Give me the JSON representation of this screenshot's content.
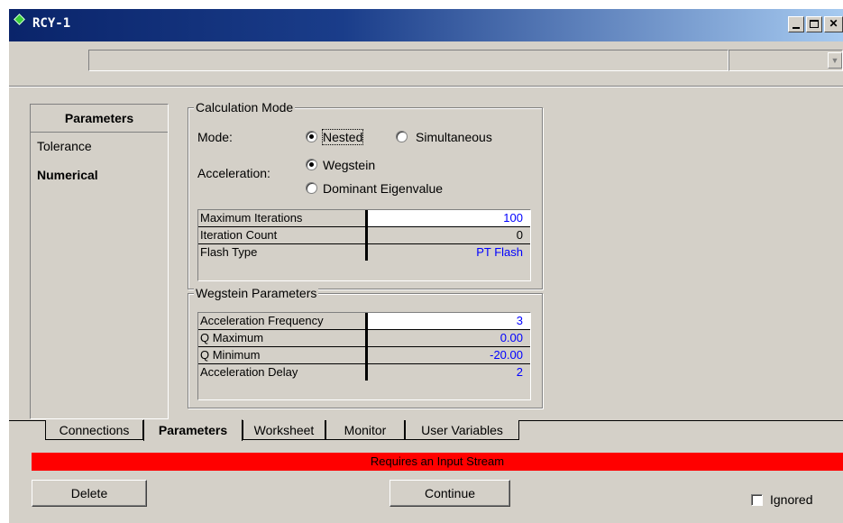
{
  "window": {
    "title": "RCY-1",
    "name_value": "",
    "combo_value": ""
  },
  "left_panel": {
    "header": "Parameters",
    "items": [
      {
        "label": "Tolerance",
        "selected": false
      },
      {
        "label": "Numerical",
        "selected": true
      }
    ]
  },
  "calc_mode": {
    "group_title": "Calculation Mode",
    "mode_label": "Mode:",
    "mode_options": [
      {
        "label": "Nested",
        "checked": true
      },
      {
        "label": "Simultaneous",
        "checked": false
      }
    ],
    "acceleration_label": "Acceleration:",
    "acceleration_options": [
      {
        "label": "Wegstein",
        "checked": true
      },
      {
        "label": "Dominant Eigenvalue",
        "checked": false
      }
    ],
    "table": [
      {
        "label": "Maximum Iterations",
        "value": "100"
      },
      {
        "label": "Iteration Count",
        "value": "0"
      },
      {
        "label": "Flash Type",
        "value": "PT Flash"
      }
    ]
  },
  "wegstein": {
    "group_title": "Wegstein Parameters",
    "table": [
      {
        "label": "Acceleration Frequency",
        "value": "3"
      },
      {
        "label": "Q Maximum",
        "value": "0.00"
      },
      {
        "label": "Q Minimum",
        "value": "-20.00"
      },
      {
        "label": "Acceleration Delay",
        "value": "2"
      }
    ]
  },
  "tabs": [
    {
      "label": "Connections",
      "active": false
    },
    {
      "label": "Parameters",
      "active": true
    },
    {
      "label": "Worksheet",
      "active": false
    },
    {
      "label": "Monitor",
      "active": false
    },
    {
      "label": "User Variables",
      "active": false
    }
  ],
  "status": {
    "text": "Requires an Input Stream",
    "color": "#ff0000"
  },
  "buttons": {
    "delete": "Delete",
    "continue": "Continue"
  },
  "ignored": {
    "label": "Ignored",
    "checked": false
  }
}
